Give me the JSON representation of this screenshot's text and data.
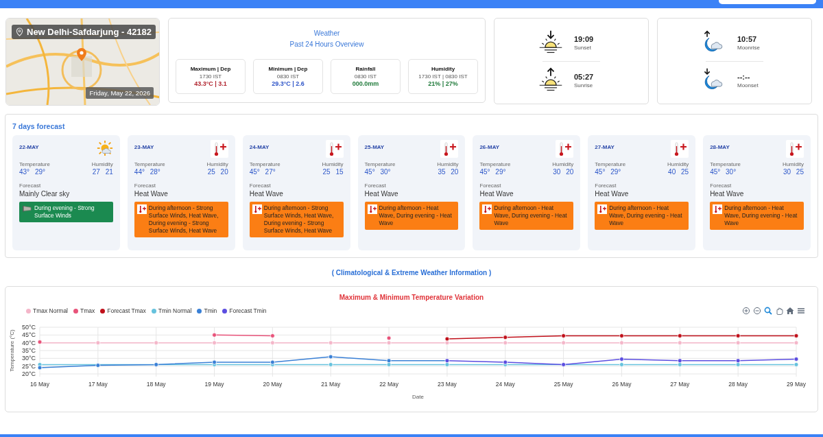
{
  "station": {
    "name": "New Delhi-Safdarjung - 42182",
    "date": "Friday, May 22, 2026"
  },
  "overview": {
    "title": "Weather",
    "subtitle": "Past 24 Hours Overview",
    "stats": [
      {
        "label": "Maximum | Dep",
        "time": "1730 IST",
        "value": "43.3°C | 3.1",
        "color": "#b0242e"
      },
      {
        "label": "Minimum | Dep",
        "time": "0830 IST",
        "value": "29.3°C | 2.6",
        "color": "#2f55c8"
      },
      {
        "label": "Rainfall",
        "time": "0830 IST",
        "value": "000.0mm",
        "color": "#1f7a3a"
      },
      {
        "label": "Humidity",
        "time": "1730 IST | 0830 IST",
        "value": "21% | 27%",
        "color": "#1f7a3a"
      }
    ]
  },
  "sun": [
    {
      "kind": "sunset",
      "time": "19:09",
      "label": "Sunset"
    },
    {
      "kind": "sunrise",
      "time": "05:27",
      "label": "Sunrise"
    }
  ],
  "moon": [
    {
      "kind": "moonrise",
      "time": "10:57",
      "label": "Moonrise"
    },
    {
      "kind": "moonset",
      "time": "--:--",
      "label": "Moonset"
    }
  ],
  "forecast": {
    "title": "7 days forecast",
    "days": [
      {
        "date": "22-MAY",
        "kind": "clear",
        "temperature_label": "Temperature",
        "temperature": [
          "43°",
          "29°"
        ],
        "humidity_label": "Humidity",
        "humidity": [
          "27",
          "21"
        ],
        "forecast_label": "Forecast",
        "forecast": "Mainly Clear sky",
        "warning": {
          "kind": "wind",
          "color": "#1b8a50",
          "text": "During evening - Strong Surface Winds"
        }
      },
      {
        "date": "23-MAY",
        "kind": "heatwave",
        "temperature_label": "Temperature",
        "temperature": [
          "44°",
          "28°"
        ],
        "humidity_label": "Humidity",
        "humidity": [
          "25",
          "20"
        ],
        "forecast_label": "Forecast",
        "forecast": "Heat Wave",
        "warning": {
          "kind": "heat",
          "color": "#fb7e14",
          "text": "During afternoon - Strong Surface Winds, Heat Wave, During evening - Strong Surface Winds, Heat Wave"
        }
      },
      {
        "date": "24-MAY",
        "kind": "heatwave",
        "temperature_label": "Temperature",
        "temperature": [
          "45°",
          "27°"
        ],
        "humidity_label": "Humidity",
        "humidity": [
          "25",
          "15"
        ],
        "forecast_label": "Forecast",
        "forecast": "Heat Wave",
        "warning": {
          "kind": "heat",
          "color": "#fb7e14",
          "text": "During afternoon - Strong Surface Winds, Heat Wave, During evening - Strong Surface Winds, Heat Wave"
        }
      },
      {
        "date": "25-MAY",
        "kind": "heatwave",
        "temperature_label": "Temperature",
        "temperature": [
          "45°",
          "30°"
        ],
        "humidity_label": "Humidity",
        "humidity": [
          "35",
          "20"
        ],
        "forecast_label": "Forecast",
        "forecast": "Heat Wave",
        "warning": {
          "kind": "heat",
          "color": "#fb7e14",
          "text": "During afternoon - Heat Wave, During evening - Heat Wave"
        }
      },
      {
        "date": "26-MAY",
        "kind": "heatwave",
        "temperature_label": "Temperature",
        "temperature": [
          "45°",
          "29°"
        ],
        "humidity_label": "Humidity",
        "humidity": [
          "30",
          "20"
        ],
        "forecast_label": "Forecast",
        "forecast": "Heat Wave",
        "warning": {
          "kind": "heat",
          "color": "#fb7e14",
          "text": "During afternoon - Heat Wave, During evening - Heat Wave"
        }
      },
      {
        "date": "27-MAY",
        "kind": "heatwave",
        "temperature_label": "Temperature",
        "temperature": [
          "45°",
          "29°"
        ],
        "humidity_label": "Humidity",
        "humidity": [
          "40",
          "25"
        ],
        "forecast_label": "Forecast",
        "forecast": "Heat Wave",
        "warning": {
          "kind": "heat",
          "color": "#fb7e14",
          "text": "During afternoon - Heat Wave, During evening - Heat Wave"
        }
      },
      {
        "date": "28-MAY",
        "kind": "heatwave",
        "temperature_label": "Temperature",
        "temperature": [
          "45°",
          "30°"
        ],
        "humidity_label": "Humidity",
        "humidity": [
          "30",
          "25"
        ],
        "forecast_label": "Forecast",
        "forecast": "Heat Wave",
        "warning": {
          "kind": "heat",
          "color": "#fb7e14",
          "text": "During afternoon - Heat Wave, During evening - Heat Wave"
        }
      }
    ]
  },
  "info_link": "( Climatological & Extreme Weather Information )",
  "chart": {
    "chart_data": {
      "type": "line",
      "title": "Maximum & Minimum Temperature Variation",
      "xlabel": "Date",
      "ylabel": "Temperature (°C)",
      "categories": [
        "16 May",
        "17 May",
        "18 May",
        "19 May",
        "20 May",
        "21 May",
        "22 May",
        "23 May",
        "24 May",
        "25 May",
        "26 May",
        "27 May",
        "28 May",
        "29 May"
      ],
      "ylim": [
        20,
        50
      ],
      "grid": true,
      "yticks": [
        {
          "value": 20,
          "label": "20°C"
        },
        {
          "value": 25,
          "label": "25°C"
        },
        {
          "value": 30,
          "label": "30°C"
        },
        {
          "value": 35,
          "label": "35°C"
        },
        {
          "value": 40,
          "label": "40°C"
        },
        {
          "value": 45,
          "label": "45°C"
        },
        {
          "value": 50,
          "label": "50°C"
        }
      ],
      "series": [
        {
          "name": "Tmax Normal",
          "color": "#f4b6c9",
          "marker": "circle",
          "values": [
            40,
            40,
            40,
            40,
            40,
            40,
            40,
            40,
            40,
            40,
            40,
            40,
            40,
            40
          ]
        },
        {
          "name": "Tmax",
          "color": "#e8537a",
          "marker": "circle",
          "values": [
            40.5,
            null,
            null,
            45,
            44.5,
            null,
            43,
            null,
            null,
            null,
            null,
            null,
            null,
            null
          ]
        },
        {
          "name": "Forecast Tmax",
          "color": "#c0101a",
          "marker": "circle",
          "values": [
            null,
            null,
            null,
            null,
            null,
            null,
            null,
            42.5,
            43.5,
            44.5,
            44.5,
            44.5,
            44.5,
            44.5
          ]
        },
        {
          "name": "Tmin Normal",
          "color": "#66c2dd",
          "marker": "circle",
          "values": [
            26,
            26,
            26,
            26,
            26,
            26,
            26,
            26,
            26,
            26,
            26,
            26,
            26,
            26
          ]
        },
        {
          "name": "Tmin",
          "color": "#3a80d6",
          "marker": "circle",
          "values": [
            24,
            25.5,
            26,
            27.5,
            27.5,
            31,
            28.5,
            28.5,
            null,
            null,
            null,
            null,
            null,
            null
          ]
        },
        {
          "name": "Forecast Tmin",
          "color": "#5b4de0",
          "marker": "circle",
          "values": [
            null,
            null,
            null,
            null,
            null,
            null,
            null,
            28.5,
            27.5,
            26,
            29.5,
            28.5,
            28.5,
            29.5
          ]
        }
      ]
    }
  }
}
